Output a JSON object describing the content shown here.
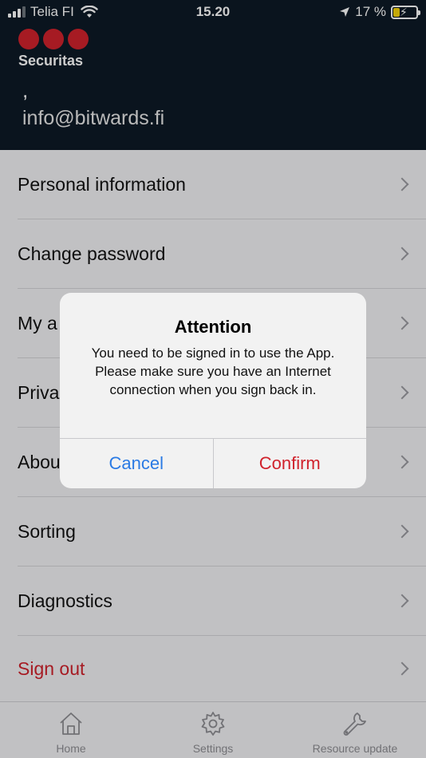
{
  "status_bar": {
    "carrier": "Telia FI",
    "time": "15.20",
    "battery_percent": "17 %"
  },
  "header": {
    "brand": "Securitas",
    "name_line": ",",
    "email": "info@bitwards.fi"
  },
  "menu": {
    "items": [
      {
        "label": "Personal information"
      },
      {
        "label": "Change password"
      },
      {
        "label": "My a"
      },
      {
        "label": "Priva"
      },
      {
        "label": "Abou"
      },
      {
        "label": "Sorting"
      },
      {
        "label": "Diagnostics"
      },
      {
        "label": "Sign out"
      }
    ]
  },
  "tabbar": {
    "tabs": [
      {
        "label": "Home",
        "icon": "house-icon"
      },
      {
        "label": "Settings",
        "icon": "gear-icon"
      },
      {
        "label": "Resource update",
        "icon": "wrench-icon"
      }
    ]
  },
  "dialog": {
    "title": "Attention",
    "message": "You need to be signed in to use the App. Please make sure you have an Internet connection when you sign back in.",
    "cancel_label": "Cancel",
    "confirm_label": "Confirm"
  },
  "colors": {
    "header_bg": "#0d1a26",
    "brand_red": "#d0222c",
    "link_blue": "#2a7ae4"
  }
}
